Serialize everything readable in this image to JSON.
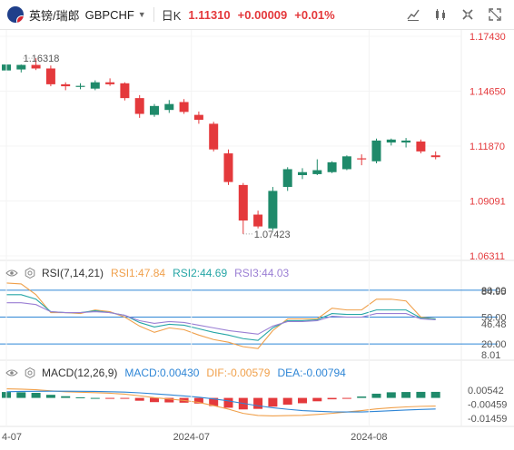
{
  "header": {
    "pair_name": "英镑/瑞郎",
    "pair_code": "GBPCHF",
    "period": "日K",
    "price": "1.11310",
    "change": "+0.00009",
    "change_pct": "+0.01%",
    "icons": [
      "drawing-tool-icon",
      "indicator-icon",
      "settings-icon",
      "fullscreen-icon"
    ]
  },
  "main_chart": {
    "yaxis_labels": [
      "1.17430",
      "1.14650",
      "1.11870",
      "1.09091",
      "1.06311"
    ],
    "yaxis_values": [
      1.1743,
      1.1465,
      1.1187,
      1.09091,
      1.06311
    ],
    "ylim": [
      1.06311,
      1.1743
    ],
    "high_label": "1.16318",
    "low_label": "1.07423",
    "up_color": "#1f8a6a",
    "down_color": "#e4393c",
    "candles": [
      {
        "o": 1.157,
        "h": 1.161,
        "l": 1.1515,
        "c": 1.16
      },
      {
        "o": 1.1575,
        "h": 1.16,
        "l": 1.156,
        "c": 1.1598
      },
      {
        "o": 1.1598,
        "h": 1.1632,
        "l": 1.1572,
        "c": 1.158
      },
      {
        "o": 1.158,
        "h": 1.1595,
        "l": 1.149,
        "c": 1.15
      },
      {
        "o": 1.15,
        "h": 1.151,
        "l": 1.147,
        "c": 1.149
      },
      {
        "o": 1.1488,
        "h": 1.1505,
        "l": 1.1475,
        "c": 1.1492
      },
      {
        "o": 1.1478,
        "h": 1.152,
        "l": 1.147,
        "c": 1.151
      },
      {
        "o": 1.151,
        "h": 1.153,
        "l": 1.1492,
        "c": 1.15
      },
      {
        "o": 1.1505,
        "h": 1.151,
        "l": 1.1418,
        "c": 1.143
      },
      {
        "o": 1.143,
        "h": 1.1445,
        "l": 1.133,
        "c": 1.135
      },
      {
        "o": 1.1345,
        "h": 1.14,
        "l": 1.1335,
        "c": 1.139
      },
      {
        "o": 1.137,
        "h": 1.142,
        "l": 1.1355,
        "c": 1.14
      },
      {
        "o": 1.141,
        "h": 1.1425,
        "l": 1.135,
        "c": 1.136
      },
      {
        "o": 1.1345,
        "h": 1.1362,
        "l": 1.13,
        "c": 1.132
      },
      {
        "o": 1.13,
        "h": 1.131,
        "l": 1.116,
        "c": 1.117
      },
      {
        "o": 1.115,
        "h": 1.117,
        "l": 1.099,
        "c": 1.1005
      },
      {
        "o": 1.099,
        "h": 1.1,
        "l": 1.0742,
        "c": 1.081
      },
      {
        "o": 1.084,
        "h": 1.086,
        "l": 1.077,
        "c": 1.078
      },
      {
        "o": 1.077,
        "h": 1.098,
        "l": 1.076,
        "c": 1.096
      },
      {
        "o": 1.098,
        "h": 1.108,
        "l": 1.096,
        "c": 1.107
      },
      {
        "o": 1.104,
        "h": 1.1075,
        "l": 1.102,
        "c": 1.1055
      },
      {
        "o": 1.1045,
        "h": 1.112,
        "l": 1.104,
        "c": 1.1065
      },
      {
        "o": 1.1055,
        "h": 1.111,
        "l": 1.105,
        "c": 1.1105
      },
      {
        "o": 1.107,
        "h": 1.114,
        "l": 1.1065,
        "c": 1.1135
      },
      {
        "o": 1.1125,
        "h": 1.1145,
        "l": 1.109,
        "c": 1.112
      },
      {
        "o": 1.111,
        "h": 1.1225,
        "l": 1.11,
        "c": 1.1215
      },
      {
        "o": 1.1205,
        "h": 1.1225,
        "l": 1.119,
        "c": 1.122
      },
      {
        "o": 1.1205,
        "h": 1.1228,
        "l": 1.118,
        "c": 1.1215
      },
      {
        "o": 1.121,
        "h": 1.122,
        "l": 1.115,
        "c": 1.116
      },
      {
        "o": 1.114,
        "h": 1.116,
        "l": 1.112,
        "c": 1.1131
      }
    ]
  },
  "rsi": {
    "name": "RSI(7,14,21)",
    "rsi1": "RSI1:47.84",
    "rsi2": "RSI2:44.69",
    "rsi3": "RSI3:44.03",
    "levels": [
      "80.00",
      "50.00",
      "20.00"
    ],
    "extra_labels": [
      "84.95",
      "46.48",
      "8.01"
    ],
    "ylim": [
      5,
      90
    ],
    "series1": [
      88,
      87,
      75,
      55,
      55,
      54,
      58,
      56,
      50,
      40,
      33,
      38,
      36,
      30,
      25,
      22,
      17,
      15,
      35,
      48,
      48,
      48,
      60,
      58,
      58,
      70,
      70,
      68,
      50,
      48
    ],
    "series2": [
      75,
      75,
      70,
      56,
      55,
      55,
      57,
      55,
      52,
      44,
      39,
      42,
      41,
      37,
      33,
      30,
      26,
      24,
      38,
      46,
      46,
      47,
      54,
      53,
      53,
      58,
      58,
      58,
      49,
      48
    ],
    "series3": [
      66,
      66,
      64,
      56,
      55,
      55,
      56,
      55,
      52,
      46,
      43,
      45,
      44,
      41,
      38,
      35,
      33,
      31,
      40,
      45,
      45,
      46,
      51,
      50,
      50,
      54,
      54,
      54,
      48,
      47
    ]
  },
  "macd": {
    "name": "MACD(12,26,9)",
    "macd_label": "MACD:0.00430",
    "dif_label": "DIF:-0.00579",
    "dea_label": "DEA:-0.00794",
    "yaxis_labels": [
      "0.00542",
      "-0.00459",
      "-0.01459"
    ],
    "ylim": [
      -0.019,
      0.012
    ],
    "hist": [
      0.0042,
      0.004,
      0.0036,
      0.0022,
      0.0012,
      0.0004,
      0.0,
      -0.0002,
      -0.0006,
      -0.002,
      -0.003,
      -0.0032,
      -0.0034,
      -0.004,
      -0.0058,
      -0.007,
      -0.0082,
      -0.0078,
      -0.0062,
      -0.0048,
      -0.0038,
      -0.0024,
      -0.001,
      -0.0002,
      0.001,
      0.003,
      0.004,
      0.0042,
      0.0043,
      0.0043
    ],
    "dif": [
      0.0065,
      0.0062,
      0.0058,
      0.005,
      0.0044,
      0.004,
      0.0037,
      0.0033,
      0.0027,
      0.0015,
      0.0002,
      -0.0008,
      -0.0018,
      -0.0032,
      -0.0055,
      -0.008,
      -0.011,
      -0.0125,
      -0.0128,
      -0.0126,
      -0.0124,
      -0.0118,
      -0.011,
      -0.01,
      -0.009,
      -0.0078,
      -0.007,
      -0.0064,
      -0.006,
      -0.0058
    ],
    "dea": [
      0.0044,
      0.0046,
      0.0047,
      0.0048,
      0.0048,
      0.0047,
      0.0046,
      0.0044,
      0.0041,
      0.0036,
      0.0029,
      0.0022,
      0.0014,
      0.0005,
      -0.0007,
      -0.0021,
      -0.0039,
      -0.0056,
      -0.007,
      -0.0081,
      -0.009,
      -0.0095,
      -0.0099,
      -0.01,
      -0.01,
      -0.0096,
      -0.0091,
      -0.0086,
      -0.0082,
      -0.0079
    ]
  },
  "xaxis": {
    "labels": [
      "4-07",
      "2024-07",
      "2024-08"
    ],
    "label_index": [
      0,
      12.5,
      24.5
    ]
  }
}
